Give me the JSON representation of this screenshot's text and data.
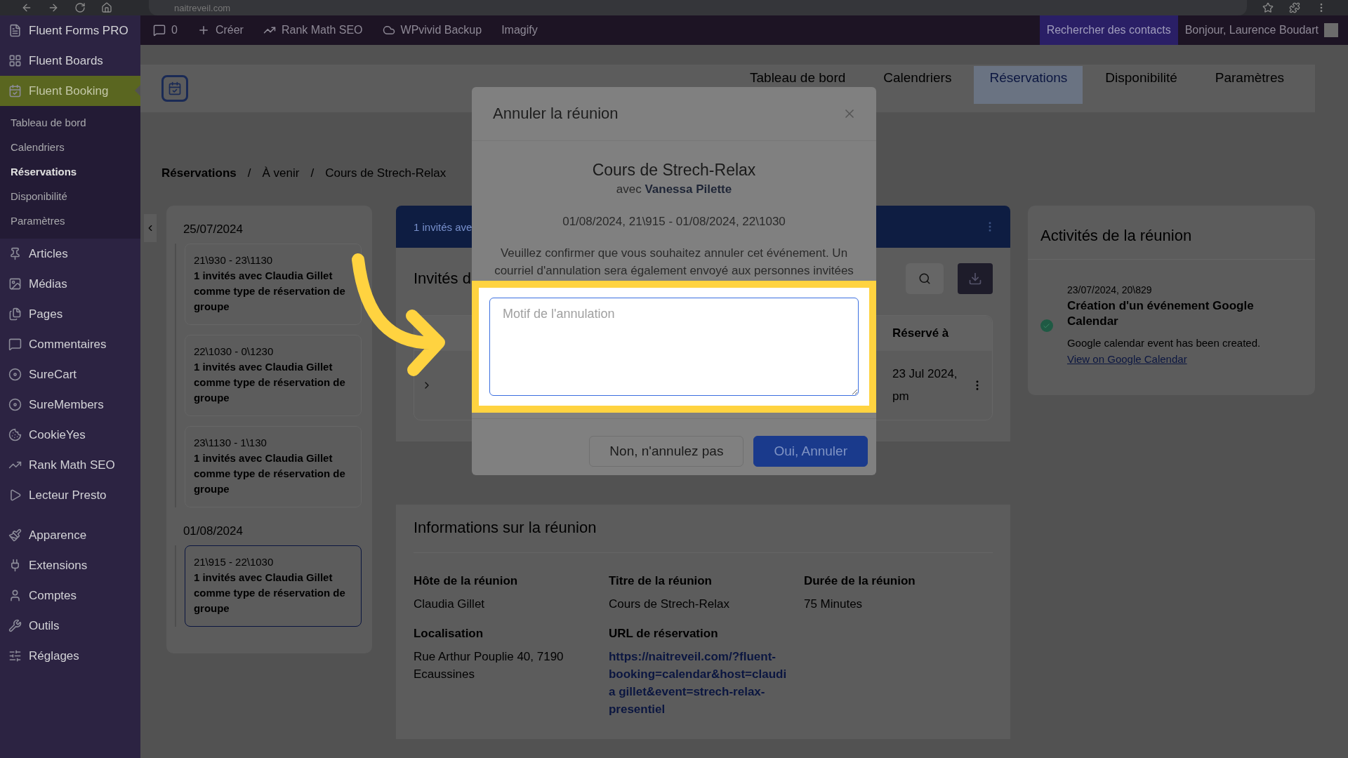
{
  "browser": {
    "url": "naitreveil.com"
  },
  "admin_bar": {
    "comments": "0",
    "items": [
      "Créer",
      "Rank Math SEO",
      "WPvivid Backup",
      "Imagify"
    ],
    "search_contacts": "Rechercher des contacts",
    "greeting": "Bonjour, Laurence Boudart"
  },
  "sidebar": {
    "sections": [
      {
        "items": [
          {
            "label": "Fluent Forms PRO",
            "selected": false
          },
          {
            "label": "Fluent Boards",
            "selected": false
          },
          {
            "label": "Fluent Booking",
            "selected": true,
            "children": [
              {
                "label": "Tableau de bord",
                "selected": false
              },
              {
                "label": "Calendriers",
                "selected": false
              },
              {
                "label": "Réservations",
                "selected": true
              },
              {
                "label": "Disponibilité",
                "selected": false
              },
              {
                "label": "Paramètres",
                "selected": false
              }
            ]
          },
          {
            "label": "Articles",
            "selected": false
          },
          {
            "label": "Médias",
            "selected": false
          },
          {
            "label": "Pages",
            "selected": false
          },
          {
            "label": "Commentaires",
            "selected": false
          },
          {
            "label": "SureCart",
            "selected": false
          },
          {
            "label": "SureMembers",
            "selected": false
          },
          {
            "label": "CookieYes",
            "selected": false
          },
          {
            "label": "Rank Math SEO",
            "selected": false
          },
          {
            "label": "Lecteur Presto",
            "selected": false
          }
        ]
      },
      {
        "items": [
          {
            "label": "Apparence",
            "selected": false
          },
          {
            "label": "Extensions",
            "selected": false
          },
          {
            "label": "Comptes",
            "selected": false
          },
          {
            "label": "Outils",
            "selected": false
          },
          {
            "label": "Réglages",
            "selected": false
          }
        ]
      }
    ]
  },
  "header": {
    "tabs": [
      {
        "label": "Tableau de bord",
        "selected": false
      },
      {
        "label": "Calendriers",
        "selected": false
      },
      {
        "label": "Réservations",
        "selected": true
      },
      {
        "label": "Disponibilité",
        "selected": false
      },
      {
        "label": "Paramètres",
        "selected": false
      }
    ]
  },
  "breadcrumb": [
    {
      "text": "Réservations",
      "kind": "current"
    },
    {
      "text": "/",
      "kind": "separator"
    },
    {
      "text": "À venir",
      "kind": "link"
    },
    {
      "text": "/",
      "kind": "separator"
    },
    {
      "text": "Cours de Strech-Relax",
      "kind": "link"
    }
  ],
  "booking_list": [
    {
      "date": "25/07/2024",
      "slots": [
        {
          "time": "21\\930 - 23\\1130",
          "text": "1 invités avec Claudia Gillet comme type de réservation de groupe",
          "selected": false
        },
        {
          "time": "22\\1030 - 0\\1230",
          "text": "1 invités avec Claudia Gillet comme type de réservation de groupe",
          "selected": false
        },
        {
          "time": "23\\1130 - 1\\130",
          "text": "1 invités avec Claudia Gillet comme type de réservation de groupe",
          "selected": false
        }
      ]
    },
    {
      "date": "01/08/2024",
      "slots": [
        {
          "time": "21\\915 - 22\\1030",
          "text": "1 invités avec Claudia Gillet comme type de réservation de groupe",
          "selected": true
        }
      ]
    }
  ],
  "banner": {
    "text": "1 invités ave"
  },
  "guests": {
    "title": "Invités d",
    "column": "Réservé à",
    "row": [
      "23 Jul 2024,",
      "pm"
    ]
  },
  "info": {
    "title": "Informations sur la réunion",
    "fields": [
      {
        "label": "Hôte de la réunion",
        "value": "Claudia Gillet",
        "kind": "text"
      },
      {
        "label": "Titre de la réunion",
        "value": "Cours de Strech-Relax",
        "kind": "text"
      },
      {
        "label": "Durée de la réunion",
        "value": "75 Minutes",
        "kind": "text"
      },
      {
        "label": "Localisation",
        "value": "Rue Arthur Pouplie 40, 7190 Ecaussines",
        "kind": "text"
      },
      {
        "label": "URL de réservation",
        "value": "https://naitreveil.com/?fluent-booking=calendar&host=claudia gillet&event=strech-relax-presentiel",
        "kind": "link"
      }
    ]
  },
  "activity": {
    "title": "Activités de la réunion",
    "items": [
      {
        "time": "23/07/2024, 20\\829",
        "title": "Création d'un événement Google Calendar",
        "text": "Google calendar event has been created.",
        "link": "View on Google Calendar",
        "done": true
      }
    ]
  },
  "modal": {
    "title": "Annuler la réunion",
    "event": "Cours de Strech-Relax",
    "host": "avec **Vanessa Pilette**",
    "datetime": "01/08/2024, 21\\915 - 01/08/2024, 22\\1030",
    "message": "Veuillez confirmer que vous souhaitez annuler cet événement. Un courriel d'annulation sera également envoyé aux personnes invitées",
    "placeholder": "Motif de l'annulation",
    "buttons": [
      {
        "label": "Non, n'annulez pas",
        "kind": "secondary"
      },
      {
        "label": "Oui, Annuler",
        "kind": "primary"
      }
    ]
  }
}
